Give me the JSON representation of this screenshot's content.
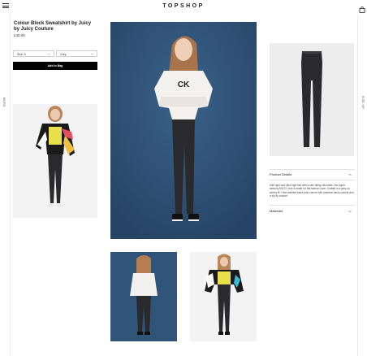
{
  "header": {
    "logo": "TOPSHOP"
  },
  "side_rails": {
    "left_label": "MORE",
    "right_label": "SIZE UP"
  },
  "product": {
    "title": "Colour Block Sweatshirt by Juicy by Juicy Couture",
    "price": "£40.00",
    "size_select": "Size: 6",
    "colour_select": "Grey",
    "add_to_bag": "Add to Bag"
  },
  "accordion": {
    "details_label": "Product Details",
    "details_text": "Slim light and ultra high rise with a skin fitting silhouette, the super-stretchy MOTO Joni is made for the fashion lover. Crafted in a grey-on skinny fit + fine washed black jean comes with practical back pockets and a zip fly closure.",
    "materials_label": "Materials"
  },
  "colors": {
    "blue_backdrop": "#2d4f73",
    "grey_backdrop": "#ededed",
    "jeans": "#2a2a2c",
    "button": "#000000"
  }
}
